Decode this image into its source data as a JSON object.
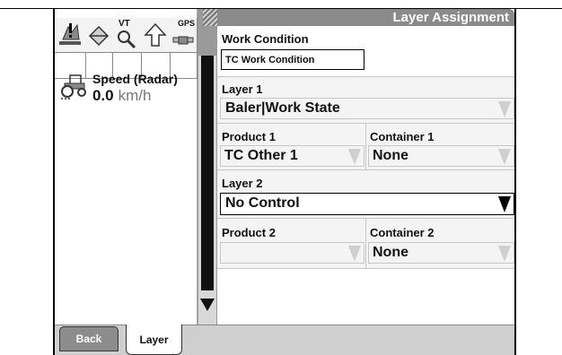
{
  "header": {
    "title": "Layer Assignment"
  },
  "status_icons": {
    "vt_label": "VT",
    "gps_label": "GPS",
    "icons": [
      "implement-alert-icon",
      "guidance-icon",
      "vt-icon",
      "up-arrow-icon",
      "gps-receiver-icon"
    ]
  },
  "speed": {
    "label": "Speed (Radar)",
    "value": "0.0",
    "unit": "km/h"
  },
  "work_condition": {
    "label": "Work Condition",
    "value": "TC Work Condition"
  },
  "layer1": {
    "label": "Layer 1",
    "value": "Baler|Work State"
  },
  "product1": {
    "label": "Product 1",
    "value": "TC Other 1"
  },
  "container1": {
    "label": "Container 1",
    "value": "None"
  },
  "layer2": {
    "label": "Layer 2",
    "value": "No Control"
  },
  "product2": {
    "label": "Product 2",
    "value": ""
  },
  "container2": {
    "label": "Container 2",
    "value": "None"
  },
  "tabs": {
    "back": "Back",
    "layer": "Layer"
  },
  "colors": {
    "title_bar": "#8a8a8a",
    "tab_bar": "#cfcfcf",
    "field_bg": "#f4f4f4"
  }
}
